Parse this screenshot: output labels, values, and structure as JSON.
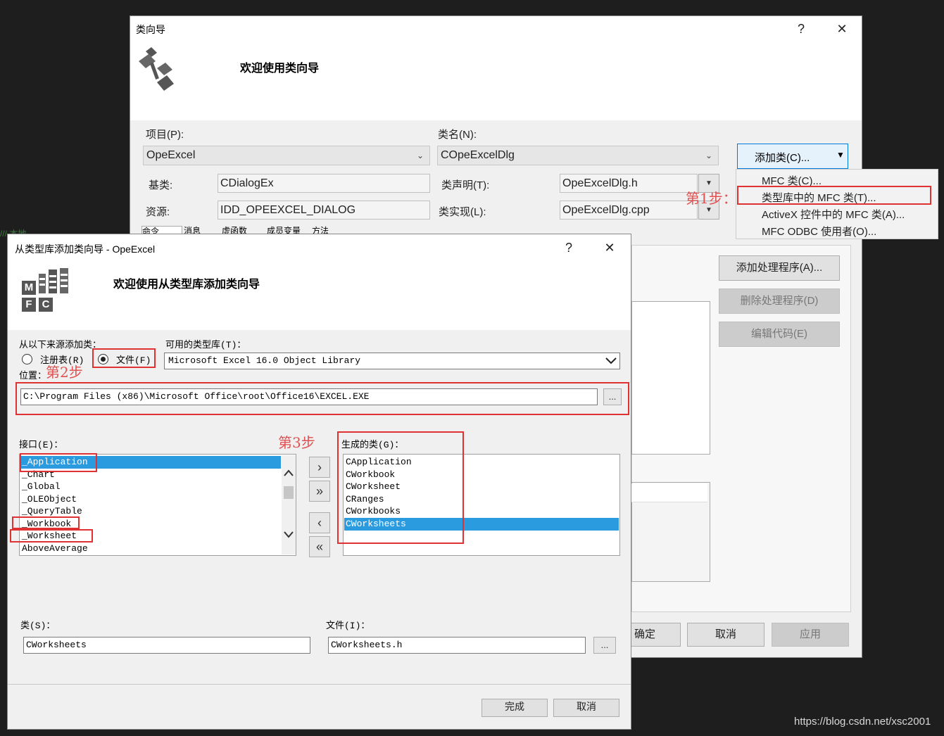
{
  "back_dialog": {
    "title": "类向导",
    "help": "?",
    "close": "✕",
    "welcome": "欢迎使用类向导",
    "project_label": "项目(P):",
    "project_value": "OpeExcel",
    "classname_label": "类名(N):",
    "classname_value": "COpeExcelDlg",
    "add_class_button": "添加类(C)...",
    "base_label": "基类:",
    "base_value": "CDialogEx",
    "resource_label": "资源:",
    "resource_value": "IDD_OPEEXCEL_DIALOG",
    "decl_label": "类声明(T):",
    "decl_value": "OpeExcelDlg.h",
    "impl_label": "类实现(L):",
    "impl_value": "OpeExcelDlg.cpp",
    "tabs": [
      "命令",
      "消息",
      "虚函数",
      "成员变量",
      "方法"
    ],
    "add_handler": "添加处理程序(A)...",
    "delete_handler": "删除处理程序(D)",
    "edit_code": "编辑代码(E)",
    "ok": "确定",
    "cancel": "取消",
    "apply": "应用",
    "menu": [
      "MFC 类(C)...",
      "类型库中的 MFC 类(T)...",
      "ActiveX 控件中的 MFC 类(A)...",
      "MFC ODBC 使用者(O)..."
    ]
  },
  "front_dialog": {
    "title": "从类型库添加类向导 - OpeExcel",
    "help": "?",
    "close": "✕",
    "welcome": "欢迎使用从类型库添加类向导",
    "source_label": "从以下来源添加类：",
    "radio_registry": "注册表(R)",
    "radio_file": "文件(F)",
    "typelib_label": "可用的类型库(T)：",
    "typelib_value": "Microsoft Excel 16.0 Object Library",
    "location_label": "位置：",
    "location_value": "C:\\Program Files (x86)\\Microsoft Office\\root\\Office16\\EXCEL.EXE",
    "browse": "...",
    "interfaces_label": "接口(E)：",
    "interfaces": [
      "_Application",
      "_Chart",
      "_Global",
      "_OLEObject",
      "_QueryTable",
      "_Workbook",
      "_Worksheet",
      "AboveAverage"
    ],
    "generated_label": "生成的类(G)：",
    "generated": [
      "CApplication",
      "CWorkbook",
      "CWorksheet",
      "CRanges",
      "CWorkbooks",
      "CWorksheets"
    ],
    "btn_add_one": "›",
    "btn_add_all": "»",
    "btn_remove_one": "‹",
    "btn_remove_all": "«",
    "class_label": "类(S)：",
    "class_value": "CWorksheets",
    "file_label": "文件(I)：",
    "file_value": "CWorksheets.h",
    "finish": "完成",
    "cancel": "取消",
    "mfc_letters": [
      "M",
      "F",
      "C"
    ]
  },
  "annotations": {
    "step1": "第1步：",
    "step2": "第2步",
    "step3": "第3步"
  },
  "bg_text": "/// 本地",
  "watermark": "https://blog.csdn.net/xsc2001",
  "colors": {
    "selection": "#2b9be0",
    "annotation": "#e03232"
  }
}
